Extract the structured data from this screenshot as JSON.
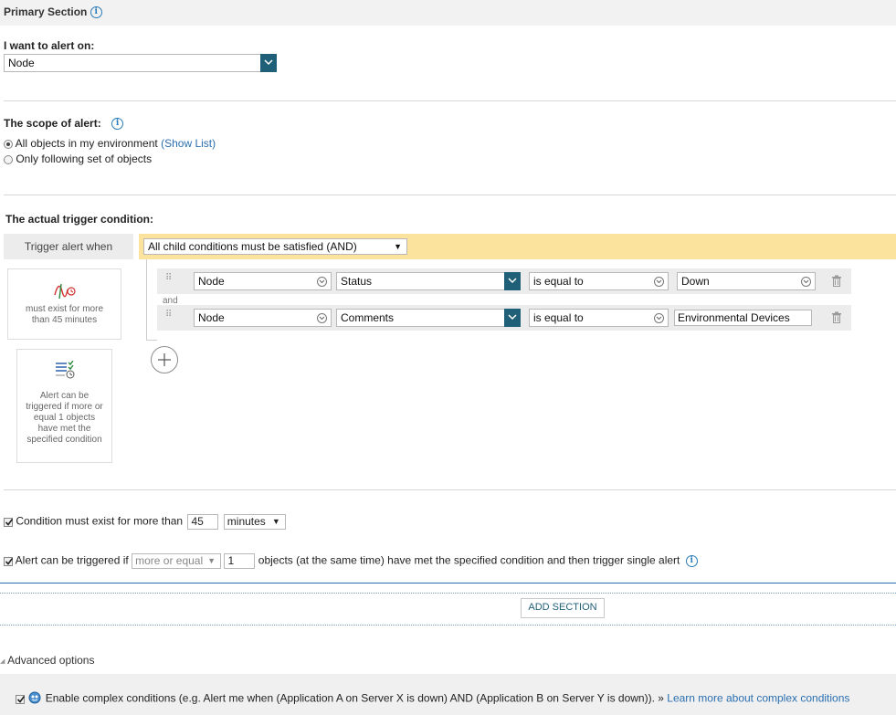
{
  "primary": {
    "title": "Primary Section"
  },
  "alert_on": {
    "label": "I want to alert on:",
    "value": "Node"
  },
  "scope": {
    "label": "The scope of alert:",
    "option_all": "All objects in my environment",
    "show_list": "(Show List)",
    "option_some": "Only following set of objects"
  },
  "trigger": {
    "label": "The actual trigger condition:",
    "when_label": "Trigger alert when",
    "when_value": "All child conditions must be satisfied (AND)",
    "and_label": "and",
    "rows": [
      {
        "object": "Node",
        "field": "Status",
        "operator": "is equal to",
        "value": "Down"
      },
      {
        "object": "Node",
        "field": "Comments",
        "operator": "is equal to",
        "value": "Environmental Devices"
      }
    ],
    "card_time": "must exist for more than 45 minutes",
    "card_objects": "Alert can be triggered if more or equal 1 objects have met the specified condition"
  },
  "condition_exist": {
    "label": "Condition must exist for more than",
    "value": "45",
    "unit": "minutes"
  },
  "alert_trigger": {
    "prefix": "Alert can be triggered if",
    "mode": "more or equal",
    "count": "1",
    "suffix": "objects (at the same time) have met the specified condition and then trigger single alert"
  },
  "add_section": {
    "label": "ADD SECTION"
  },
  "advanced": {
    "label": "Advanced options",
    "complex_text": "Enable complex conditions (e.g. Alert me when (Application A on Server X is down) AND (Application B on Server Y is down)). »",
    "complex_link": "Learn more about complex conditions"
  }
}
